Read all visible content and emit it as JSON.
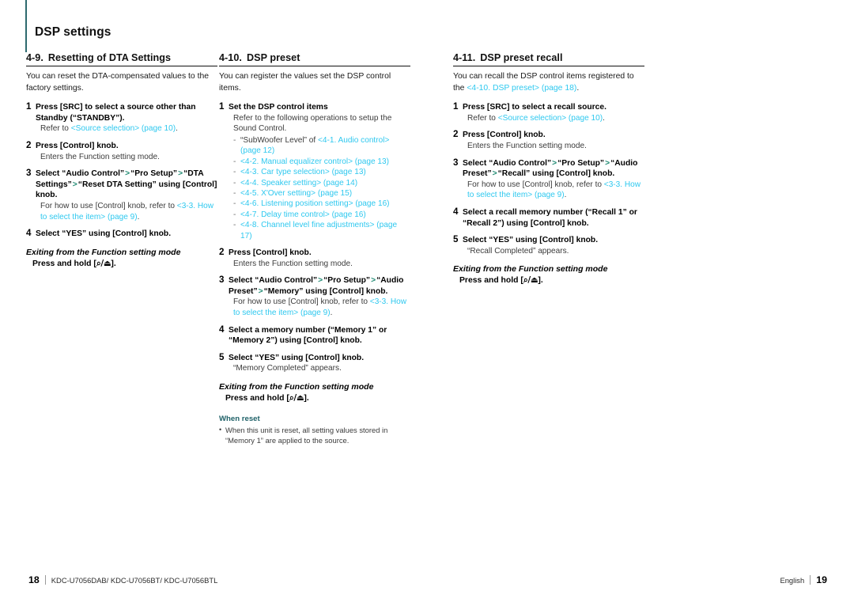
{
  "header": {
    "title": "DSP settings",
    "accent_color": "#2d6a6e"
  },
  "colors": {
    "link": "#2ec8ef",
    "separator": "#1f8a72",
    "note_heading": "#1f6168"
  },
  "columns": [
    {
      "heading_number": "4-9.",
      "heading_title": "Resetting of DTA Settings",
      "intro": "You can reset the DTA-compensated values to the factory settings.",
      "steps": [
        {
          "num": "1",
          "title_parts": [
            {
              "t": "Press [SRC] to select a source other than Standby (“STANDBY”).",
              "k": "plain"
            }
          ],
          "note_parts": [
            {
              "t": "Refer to ",
              "k": "plain"
            },
            {
              "t": "<Source selection> (page 10)",
              "k": "link"
            },
            {
              "t": ".",
              "k": "plain"
            }
          ]
        },
        {
          "num": "2",
          "title_parts": [
            {
              "t": "Press [Control] knob.",
              "k": "plain"
            }
          ],
          "note_parts": [
            {
              "t": "Enters the Function setting mode.",
              "k": "plain"
            }
          ]
        },
        {
          "num": "3",
          "title_parts": [
            {
              "t": "Select “Audio Control”",
              "k": "plain"
            },
            {
              "t": ">",
              "k": "sep"
            },
            {
              "t": "“Pro Setup”",
              "k": "plain"
            },
            {
              "t": ">",
              "k": "sep"
            },
            {
              "t": "“DTA Settings”",
              "k": "plain"
            },
            {
              "t": ">",
              "k": "sep"
            },
            {
              "t": "“Reset DTA Setting” using [Control] knob.",
              "k": "plain"
            }
          ],
          "note_parts": [
            {
              "t": "For how to use [Control] knob, refer to ",
              "k": "plain"
            },
            {
              "t": "<3-3. How to select the item> (page 9)",
              "k": "link"
            },
            {
              "t": ".",
              "k": "plain"
            }
          ]
        },
        {
          "num": "4",
          "title_parts": [
            {
              "t": "Select “YES” using [Control] knob.",
              "k": "plain"
            }
          ],
          "note_parts": []
        }
      ],
      "exit_heading": "Exiting from the Function setting mode",
      "exit_body": "Press and hold [⌕/⏏].",
      "ref_list": [],
      "note_block": null
    },
    {
      "heading_number": "4-10.",
      "heading_title": "DSP preset",
      "intro": "You can register the values set the DSP control items.",
      "steps": [
        {
          "num": "1",
          "title_parts": [
            {
              "t": "Set the DSP control items",
              "k": "plain"
            }
          ],
          "note_parts": [
            {
              "t": "Refer to the following operations to setup the Sound Control.",
              "k": "plain"
            }
          ],
          "ref_list": [
            [
              {
                "t": "“SubWoofer Level” of ",
                "k": "plain"
              },
              {
                "t": "<4-1. Audio control> (page 12)",
                "k": "link"
              }
            ],
            [
              {
                "t": "<4-2. Manual equalizer control> (page 13)",
                "k": "link"
              }
            ],
            [
              {
                "t": "<4-3. Car type selection> (page 13)",
                "k": "link"
              }
            ],
            [
              {
                "t": "<4-4. Speaker setting> (page 14)",
                "k": "link"
              }
            ],
            [
              {
                "t": "<4-5. X'Over setting> (page 15)",
                "k": "link"
              }
            ],
            [
              {
                "t": "<4-6. Listening position setting> (page 16)",
                "k": "link"
              }
            ],
            [
              {
                "t": "<4-7. Delay time control> (page 16)",
                "k": "link"
              }
            ],
            [
              {
                "t": "<4-8. Channel level fine adjustments> (page 17)",
                "k": "link"
              }
            ]
          ]
        },
        {
          "num": "2",
          "title_parts": [
            {
              "t": "Press [Control] knob.",
              "k": "plain"
            }
          ],
          "note_parts": [
            {
              "t": "Enters the Function setting mode.",
              "k": "plain"
            }
          ]
        },
        {
          "num": "3",
          "title_parts": [
            {
              "t": "Select “Audio Control”",
              "k": "plain"
            },
            {
              "t": ">",
              "k": "sep"
            },
            {
              "t": "“Pro Setup”",
              "k": "plain"
            },
            {
              "t": ">",
              "k": "sep"
            },
            {
              "t": "“Audio Preset”",
              "k": "plain"
            },
            {
              "t": ">",
              "k": "sep"
            },
            {
              "t": "“Memory” using [Control] knob.",
              "k": "plain"
            }
          ],
          "note_parts": [
            {
              "t": "For how to use [Control] knob, refer to ",
              "k": "plain"
            },
            {
              "t": "<3-3. How to select the item> (page 9)",
              "k": "link"
            },
            {
              "t": ".",
              "k": "plain"
            }
          ]
        },
        {
          "num": "4",
          "title_parts": [
            {
              "t": "Select a memory number (“Memory 1” or “Memory 2”) using [Control] knob.",
              "k": "plain"
            }
          ],
          "note_parts": []
        },
        {
          "num": "5",
          "title_parts": [
            {
              "t": "Select “YES” using [Control] knob.",
              "k": "plain"
            }
          ],
          "note_parts": [
            {
              "t": "“Memory Completed” appears.",
              "k": "plain"
            }
          ]
        }
      ],
      "exit_heading": "Exiting from the Function setting mode",
      "exit_body": "Press and hold [⌕/⏏].",
      "note_block": {
        "heading": "When reset",
        "items": [
          "When this unit is reset, all setting values stored in “Memory 1” are applied to the source."
        ]
      }
    },
    {
      "heading_number": "4-11.",
      "heading_title": "DSP preset recall",
      "intro_parts": [
        {
          "t": "You can recall the DSP control items registered to the ",
          "k": "plain"
        },
        {
          "t": "<4-10. DSP preset> (page 18)",
          "k": "link"
        },
        {
          "t": ".",
          "k": "plain"
        }
      ],
      "steps": [
        {
          "num": "1",
          "title_parts": [
            {
              "t": "Press [SRC] to select a recall source.",
              "k": "plain"
            }
          ],
          "note_parts": [
            {
              "t": "Refer to ",
              "k": "plain"
            },
            {
              "t": "<Source selection> (page 10)",
              "k": "link"
            },
            {
              "t": ".",
              "k": "plain"
            }
          ]
        },
        {
          "num": "2",
          "title_parts": [
            {
              "t": "Press [Control] knob.",
              "k": "plain"
            }
          ],
          "note_parts": [
            {
              "t": "Enters the Function setting mode.",
              "k": "plain"
            }
          ]
        },
        {
          "num": "3",
          "title_parts": [
            {
              "t": "Select “Audio Control”",
              "k": "plain"
            },
            {
              "t": ">",
              "k": "sep"
            },
            {
              "t": "“Pro Setup”",
              "k": "plain"
            },
            {
              "t": ">",
              "k": "sep"
            },
            {
              "t": "“Audio Preset”",
              "k": "plain"
            },
            {
              "t": ">",
              "k": "sep"
            },
            {
              "t": "“Recall” using [Control] knob.",
              "k": "plain"
            }
          ],
          "note_parts": [
            {
              "t": "For how to use [Control] knob, refer to ",
              "k": "plain"
            },
            {
              "t": "<3-3. How to select the item> (page 9)",
              "k": "link"
            },
            {
              "t": ".",
              "k": "plain"
            }
          ]
        },
        {
          "num": "4",
          "title_parts": [
            {
              "t": "Select a recall memory number (“Recall 1” or “Recall 2”) using [Control] knob.",
              "k": "plain"
            }
          ],
          "note_parts": []
        },
        {
          "num": "5",
          "title_parts": [
            {
              "t": "Select “YES” using [Control] knob.",
              "k": "plain"
            }
          ],
          "note_parts": [
            {
              "t": "“Recall Completed” appears.",
              "k": "plain"
            }
          ]
        }
      ],
      "exit_heading": "Exiting from the Function setting mode",
      "exit_body": "Press and hold [⌕/⏏].",
      "note_block": null
    }
  ],
  "footer": {
    "left_page": "18",
    "models": "KDC-U7056DAB/ KDC-U7056BT/ KDC-U7056BTL",
    "language": "English",
    "right_page": "19"
  }
}
